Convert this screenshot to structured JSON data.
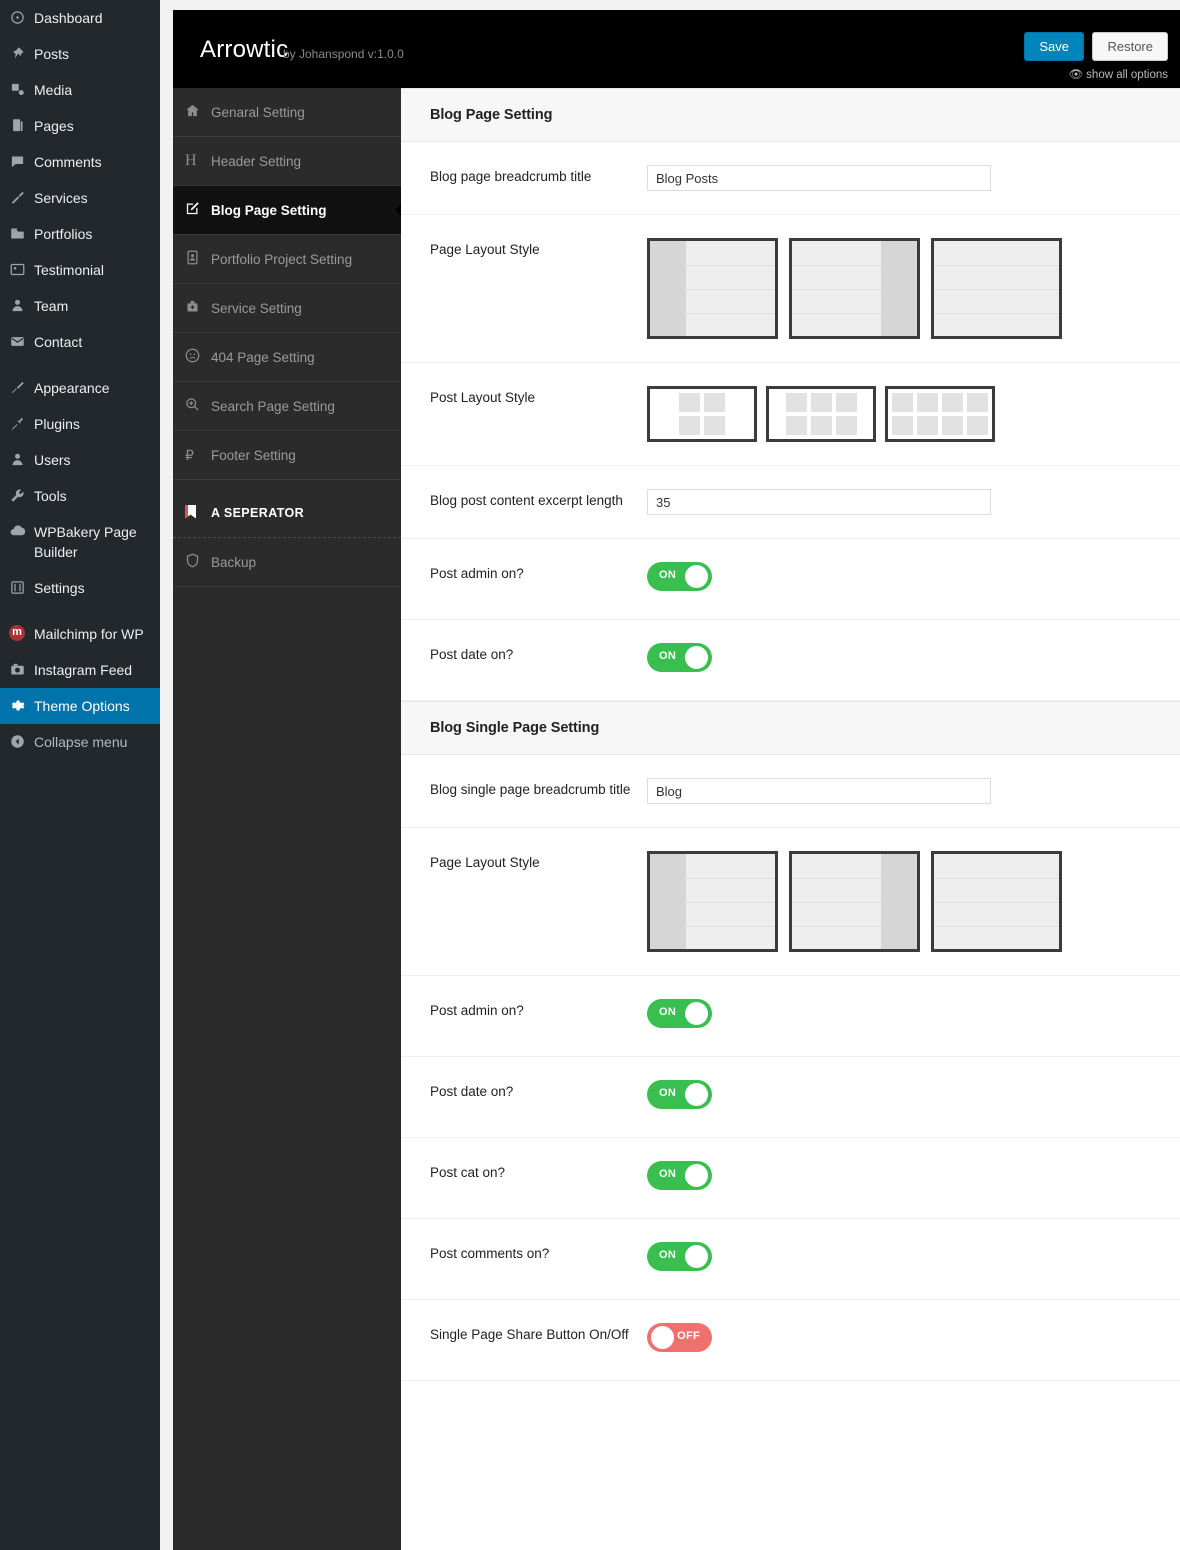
{
  "wp_menu": {
    "items": [
      {
        "label": "Dashboard",
        "icon": "dashboard-icon"
      },
      {
        "label": "Posts",
        "icon": "pin-icon"
      },
      {
        "label": "Media",
        "icon": "media-icon"
      },
      {
        "label": "Pages",
        "icon": "pages-icon"
      },
      {
        "label": "Comments",
        "icon": "comment-icon"
      },
      {
        "label": "Services",
        "icon": "hammer-icon"
      },
      {
        "label": "Portfolios",
        "icon": "portfolio-icon"
      },
      {
        "label": "Testimonial",
        "icon": "testimonial-icon"
      },
      {
        "label": "Team",
        "icon": "user-icon"
      },
      {
        "label": "Contact",
        "icon": "envelope-icon"
      },
      {
        "label": "Appearance",
        "icon": "brush-icon"
      },
      {
        "label": "Plugins",
        "icon": "plug-icon"
      },
      {
        "label": "Users",
        "icon": "users-icon"
      },
      {
        "label": "Tools",
        "icon": "wrench-icon"
      },
      {
        "label": "WPBakery Page Builder",
        "icon": "cloud-icon"
      },
      {
        "label": "Settings",
        "icon": "sliders-icon"
      },
      {
        "label": "Mailchimp for WP",
        "icon": "mailchimp-icon"
      },
      {
        "label": "Instagram Feed",
        "icon": "camera-icon"
      },
      {
        "label": "Theme Options",
        "icon": "gear-icon"
      },
      {
        "label": "Collapse menu",
        "icon": "collapse-icon"
      }
    ],
    "active": "Theme Options"
  },
  "panel": {
    "title": "Arrowtic",
    "subtitle": "by Johanspond v:1.0.0",
    "save_label": "Save",
    "restore_label": "Restore",
    "show_all_label": "show all options",
    "accent_color": "#0085ba"
  },
  "options_nav": {
    "items": [
      {
        "label": "Genaral Setting",
        "icon": "home-icon",
        "active": false
      },
      {
        "label": "Header Setting",
        "icon": "header-h-icon",
        "active": false
      },
      {
        "label": "Blog Page Setting",
        "icon": "pencil-square-icon",
        "active": true
      },
      {
        "label": "Portfolio Project Setting",
        "icon": "portrait-icon",
        "active": false
      },
      {
        "label": "Service Setting",
        "icon": "briefcase-medical-icon",
        "active": false
      },
      {
        "label": "404 Page Setting",
        "icon": "frown-icon",
        "active": false
      },
      {
        "label": "Search Page Setting",
        "icon": "search-plus-icon",
        "active": false
      },
      {
        "label": "Footer Setting",
        "icon": "ruble-icon",
        "active": false
      }
    ],
    "separator_label": "A SEPERATOR",
    "separator_icon": "bookmark-icon",
    "backup": {
      "label": "Backup",
      "icon": "shield-icon"
    }
  },
  "sections": [
    {
      "heading": "Blog Page Setting",
      "rows": [
        {
          "type": "text",
          "label": "Blog page breadcrumb title",
          "value": "Blog Posts",
          "placeholder": ""
        },
        {
          "type": "page-layout",
          "label": "Page Layout Style",
          "selected": 0,
          "options": [
            "left-sidebar",
            "right-sidebar",
            "full-width"
          ]
        },
        {
          "type": "post-layout",
          "label": "Post Layout Style",
          "selected": 0,
          "options": [
            "2-column",
            "3-column",
            "4-column"
          ]
        },
        {
          "type": "text",
          "label": "Blog post content excerpt length",
          "value": "35",
          "placeholder": ""
        },
        {
          "type": "toggle",
          "label": "Post admin on?",
          "state": "on",
          "on_label": "ON",
          "off_label": "OFF"
        },
        {
          "type": "toggle",
          "label": "Post date on?",
          "state": "on",
          "on_label": "ON",
          "off_label": "OFF"
        }
      ]
    },
    {
      "heading": "Blog Single Page Setting",
      "rows": [
        {
          "type": "text",
          "label": "Blog single page breadcrumb title",
          "value": "Blog",
          "placeholder": ""
        },
        {
          "type": "page-layout",
          "label": "Page Layout Style",
          "selected": 0,
          "options": [
            "left-sidebar",
            "right-sidebar",
            "full-width"
          ]
        },
        {
          "type": "toggle",
          "label": "Post admin on?",
          "state": "on",
          "on_label": "ON",
          "off_label": "OFF"
        },
        {
          "type": "toggle",
          "label": "Post date on?",
          "state": "on",
          "on_label": "ON",
          "off_label": "OFF"
        },
        {
          "type": "toggle",
          "label": "Post cat on?",
          "state": "on",
          "on_label": "ON",
          "off_label": "OFF"
        },
        {
          "type": "toggle",
          "label": "Post comments on?",
          "state": "on",
          "on_label": "ON",
          "off_label": "OFF"
        },
        {
          "type": "toggle",
          "label": "Single Page Share Button On/Off",
          "state": "off",
          "on_label": "ON",
          "off_label": "OFF"
        }
      ]
    }
  ],
  "colors": {
    "toggle_on": "#38bf4f",
    "toggle_off": "#f07070",
    "wp_sidebar": "#23282d",
    "wp_active": "#0073aa",
    "options_nav": "#2b2b2b",
    "options_active": "#111111"
  }
}
